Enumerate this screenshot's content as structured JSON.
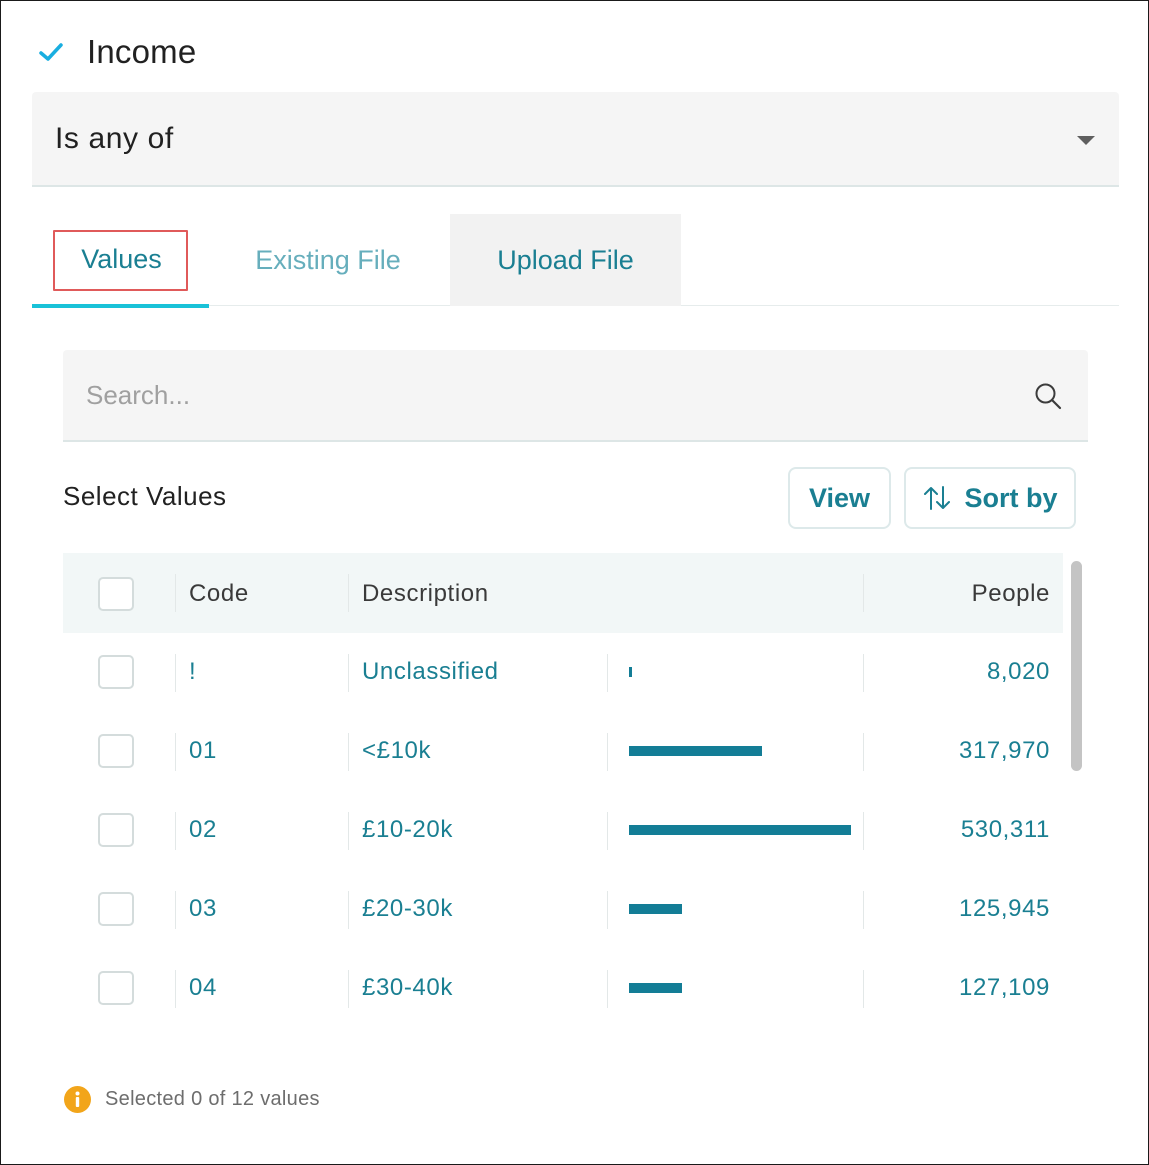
{
  "header": {
    "title": "Income"
  },
  "operator": {
    "value": "Is any of"
  },
  "tabs": [
    {
      "label": "Values",
      "active": true
    },
    {
      "label": "Existing File",
      "active": false
    },
    {
      "label": "Upload File",
      "active": false
    }
  ],
  "search": {
    "placeholder": "Search..."
  },
  "section": {
    "label": "Select Values"
  },
  "buttons": {
    "view": "View",
    "sort": "Sort by"
  },
  "table": {
    "headers": {
      "code": "Code",
      "description": "Description",
      "people": "People"
    },
    "max_people": 530311,
    "rows": [
      {
        "code": "!",
        "description": "Unclassified",
        "people": "8,020",
        "people_value": 8020
      },
      {
        "code": "01",
        "description": "<£10k",
        "people": "317,970",
        "people_value": 317970
      },
      {
        "code": "02",
        "description": "£10-20k",
        "people": "530,311",
        "people_value": 530311
      },
      {
        "code": "03",
        "description": "£20-30k",
        "people": "125,945",
        "people_value": 125945
      },
      {
        "code": "04",
        "description": "£30-40k",
        "people": "127,109",
        "people_value": 127109
      }
    ]
  },
  "footer": {
    "text": "Selected 0 of 12 values"
  },
  "colors": {
    "accent": "#1a7f92",
    "tab_underline": "#19c2d8",
    "bar": "#137d96",
    "info": "#f2a51a",
    "highlight": "#e05a5a"
  }
}
